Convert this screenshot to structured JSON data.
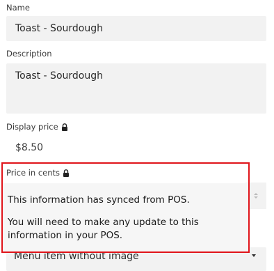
{
  "form": {
    "name": {
      "label": "Name",
      "value": "Toast - Sourdough"
    },
    "description": {
      "label": "Description",
      "value": "Toast - Sourdough"
    },
    "display_price": {
      "label": "Display price",
      "value": "$8.50",
      "locked_icon": "lock-icon"
    },
    "price_in_cents": {
      "label": "Price in cents",
      "locked_icon": "lock-icon",
      "stepper_icon": "stepper-arrows-icon"
    },
    "image_type": {
      "selected": "Menu item without image",
      "caret_icon": "chevron-down-icon"
    }
  },
  "tooltip": {
    "line1": "This information has synced from POS.",
    "line2": "You will need to make any update to this information in your POS.",
    "highlight_color": "#e0141a"
  }
}
